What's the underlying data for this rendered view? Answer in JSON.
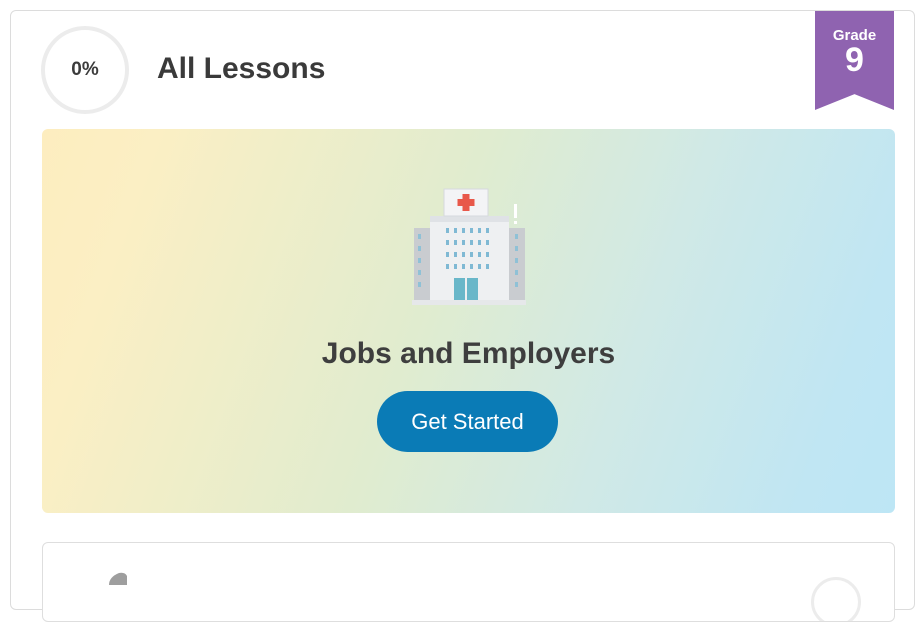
{
  "progress": {
    "percent_label": "0%",
    "value": 0
  },
  "header": {
    "title": "All Lessons"
  },
  "grade_badge": {
    "label": "Grade",
    "number": "9",
    "color": "#8f63b0"
  },
  "featured_lesson": {
    "icon": "hospital-building-icon",
    "title": "Jobs and Employers",
    "button_label": "Get Started",
    "button_color": "#0a7bb6"
  },
  "next_lesson": {
    "icon": "partial-lesson-icon"
  }
}
